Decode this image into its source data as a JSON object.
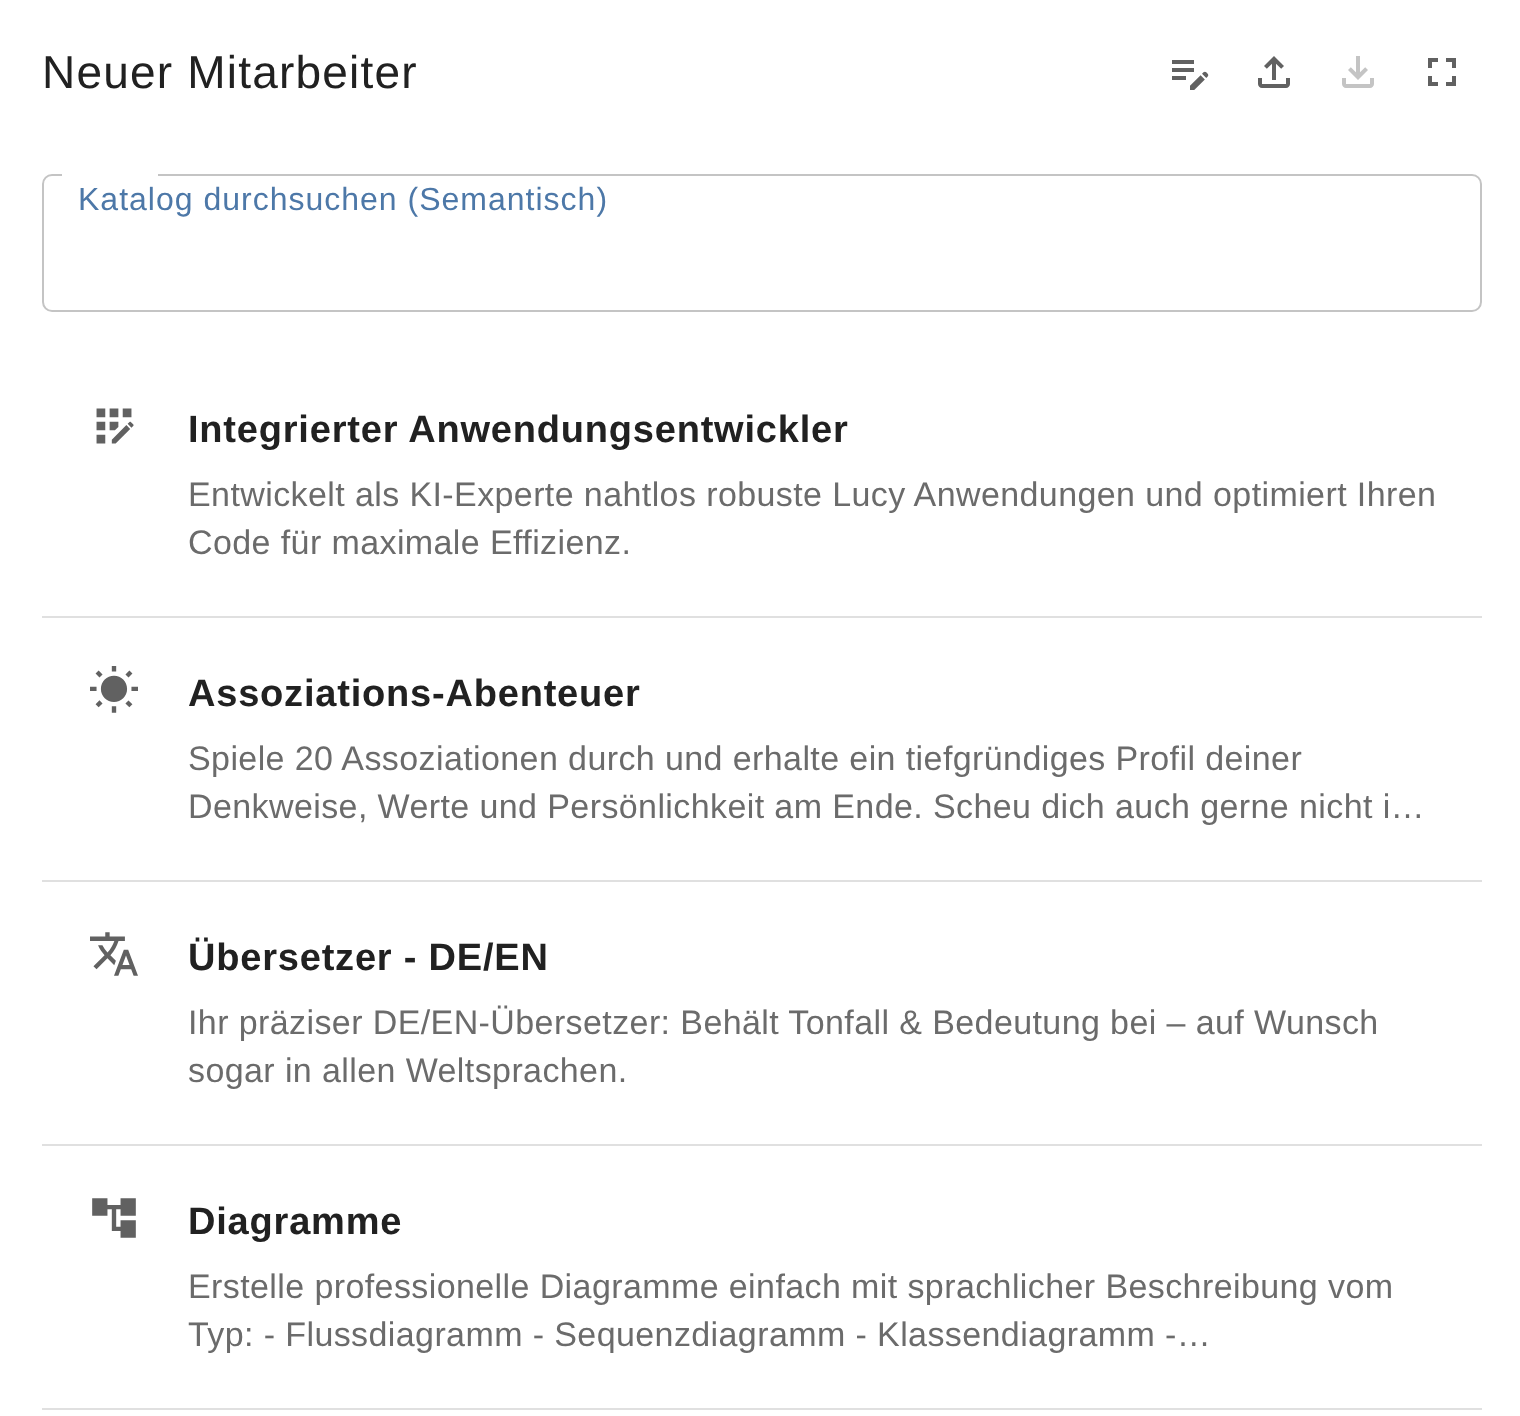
{
  "header": {
    "title": "Neuer Mitarbeiter",
    "actions": [
      {
        "kind": "edit",
        "disabled": false
      },
      {
        "kind": "upload",
        "disabled": false
      },
      {
        "kind": "download",
        "disabled": true
      },
      {
        "kind": "fullscreen",
        "disabled": false
      }
    ]
  },
  "search": {
    "label": "Katalog durchsuchen (Semantisch)"
  },
  "items": [
    {
      "kind": "app",
      "title": "Integrierter Anwendungsentwickler",
      "description": "Entwickelt als KI-Experte nahtlos robuste Lucy Anwendungen und optimiert Ihren Code für maximale Effizienz."
    },
    {
      "kind": "sun",
      "title": "Assoziations-Abenteuer",
      "description": "Spiele 20 Assoziationen durch und erhalte ein tiefgründiges Profil deiner Denkweise, Werte und Persönlichkeit am Ende. Scheu dich auch gerne nicht i…"
    },
    {
      "kind": "translate",
      "title": "Übersetzer - DE/EN",
      "description": "Ihr präziser DE/EN-Übersetzer: Behält Tonfall & Bedeutung bei – auf Wunsch sogar in allen Weltsprachen."
    },
    {
      "kind": "tree",
      "title": "Diagramme",
      "description": "Erstelle professionelle Diagramme einfach mit sprachlicher Beschreibung vom Typ: - Flussdiagramm - Sequenzdiagramm - Klassendiagramm -…"
    }
  ]
}
